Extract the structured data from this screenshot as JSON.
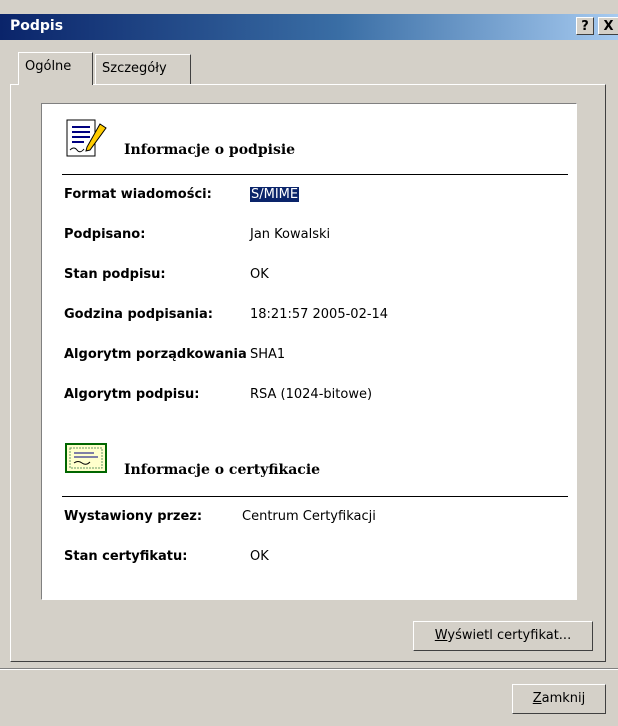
{
  "window": {
    "title": "Podpis",
    "help_button": "?",
    "close_button": "X"
  },
  "tabs": [
    {
      "label": "Ogólne",
      "active": true
    },
    {
      "label": "Szczegóły",
      "active": false
    }
  ],
  "signature_section": {
    "title": "Informacje o podpisie",
    "icon": "signed-document-icon",
    "rows": [
      {
        "label": "Format wiadomości:",
        "value": "S/MIME",
        "selected": true
      },
      {
        "label": "Podpisano:",
        "value": "Jan Kowalski"
      },
      {
        "label": "Stan podpisu:",
        "value": "OK"
      },
      {
        "label": "Godzina podpisania:",
        "value": "18:21:57 2005-02-14"
      },
      {
        "label": "Algorytm porządkowania:",
        "value": "SHA1"
      },
      {
        "label": "Algorytm podpisu:",
        "value": "RSA (1024-bitowe)"
      }
    ]
  },
  "certificate_section": {
    "title": "Informacje o certyfikacie",
    "icon": "certificate-icon",
    "rows": [
      {
        "label": "Wystawiony przez:",
        "value": "Centrum Certyfikacji"
      },
      {
        "label": "Stan certyfikatu:",
        "value": "OK"
      }
    ]
  },
  "buttons": {
    "view_certificate": {
      "mnemonic": "W",
      "rest": "yświetl certyfikat..."
    },
    "close": {
      "mnemonic": "Z",
      "rest": "amknij"
    }
  },
  "colors": {
    "titlebar_start": "#0a246a",
    "titlebar_end": "#a6caf0",
    "dialog_face": "#d4d0c8",
    "selection": "#0a246a"
  }
}
